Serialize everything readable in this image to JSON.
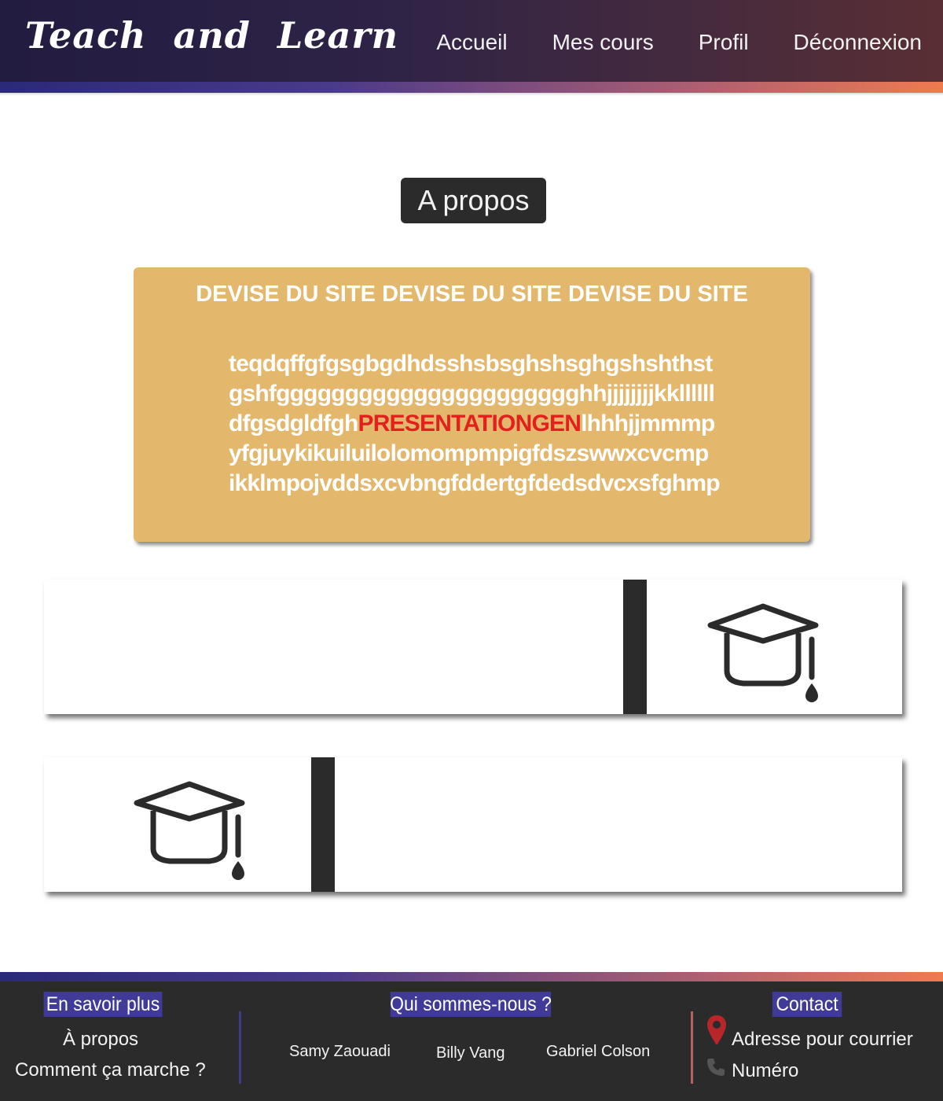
{
  "header": {
    "logo": "Teach  and  Learn",
    "nav": [
      "Accueil",
      "Mes cours",
      "Profil",
      "Déconnexion"
    ]
  },
  "main": {
    "title": "A propos",
    "motto": {
      "heading": "DEVISE DU SITE DEVISE DU SITE DEVISE DU SITE",
      "line1": "teqdqffgfgsgbgdhdsshsbsghshsghgshshthst",
      "line2": "gshfgggggggggggggggggggggghhjjjjjjjjkkllllll",
      "line3_before": "dfgsdgldfgh",
      "line3_highlight": "PRESENTATIONGEN",
      "line3_after": "lhhhjjmmmp",
      "line4": "yfgjuykikuiluilolomompmpigfdszswwxcvcmp",
      "line5": "ikklmpojvddsxcvbngfddertgfdedsdvcxsfghmp"
    },
    "cards": [
      {
        "icon": "graduation-cap-icon"
      },
      {
        "icon": "graduation-cap-icon"
      }
    ]
  },
  "footer": {
    "learn_more": {
      "heading": "En savoir plus",
      "links": [
        "À propos",
        "Comment ça marche ?"
      ]
    },
    "about": {
      "heading": "Qui sommes-nous ?",
      "names": [
        "Samy Zaouadi",
        "Billy Vang",
        "Gabriel Colson"
      ]
    },
    "contact": {
      "heading": "Contact",
      "address": "Adresse pour courrier",
      "phone": "Numéro",
      "icons": [
        "map-pin-icon",
        "phone-icon"
      ]
    }
  },
  "colors": {
    "motto_bg": "#e3b86d",
    "highlight": "#e3211c",
    "footer_heading_bg": "#3f3b96",
    "dark": "#2b2b2b"
  }
}
